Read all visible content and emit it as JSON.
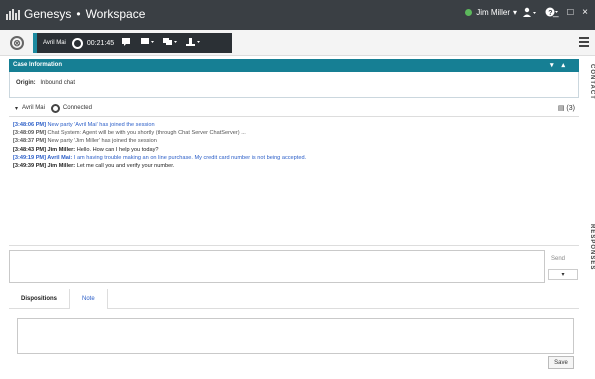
{
  "titlebar": {
    "brand": "Genesys",
    "separator": "•",
    "app": "Workspace",
    "agent_name": "Jim Miller",
    "caret": "▾",
    "agent_icon": "person-icon",
    "help_icon": "help-icon",
    "window_controls": "_ □ ×"
  },
  "toolbar": {
    "close_icon": "⊗",
    "party": "Avril Mai",
    "timer": "00:21:45",
    "icons": [
      "chat-icon",
      "transfer-icon",
      "conference-icon",
      "consult-icon"
    ]
  },
  "case": {
    "header": "Case Information",
    "origin_label": "Origin:",
    "origin_value": "Inbound chat"
  },
  "side_tabs": {
    "contacts": "CONTACT",
    "responses": "RESPONSES"
  },
  "interaction": {
    "party": "Avril Mai",
    "status": "Connected",
    "right_icon": "▤ (3)"
  },
  "transcript": [
    {
      "time": "[3:48:06 PM]",
      "text": " New party 'Avril Mai' has joined the session",
      "style": "blue"
    },
    {
      "time": "[3:48:09 PM]",
      "text": " Chat System: Agent will be with you shortly (through Chat Server ChatServer) ...",
      "style": "grey"
    },
    {
      "time": "[3:48:37 PM]",
      "text": " New party 'Jim Miller' has joined the session",
      "style": "grey"
    },
    {
      "time": "[3:48:43 PM] Jim Miller:",
      "text": " Hello. How can I help you today?",
      "style": "dark"
    },
    {
      "time": "[3:49:19 PM] Avril Mai:",
      "text": " I am having trouble making an on line purchase. My credit card number is not being accepted.",
      "style": "blue"
    },
    {
      "time": "[3:49:39 PM] Jim Miller:",
      "text": " Let me call you and verify your number.",
      "style": "dark"
    }
  ],
  "compose": {
    "send": "Send",
    "send_options": "▾"
  },
  "tabs": {
    "dispositions": "Dispositions",
    "note": "Note"
  },
  "note": {
    "save": "Save"
  }
}
